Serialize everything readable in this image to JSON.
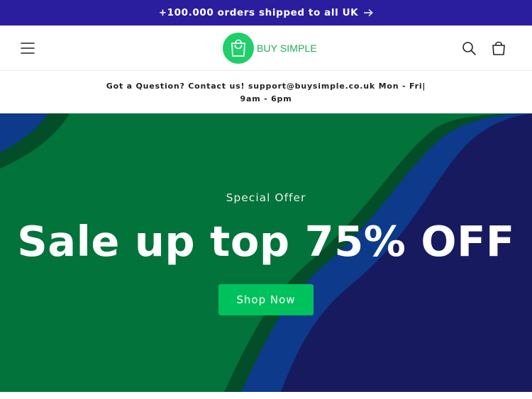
{
  "announcement": {
    "text": "+100.000 orders shipped to all UK",
    "arrow_icon": "arrow-right-icon"
  },
  "header": {
    "brand": "BUY SIMPLE",
    "icons": {
      "menu": "hamburger-menu-icon",
      "logo": "shopping-bag-icon",
      "search": "search-icon",
      "cart": "cart-icon"
    }
  },
  "contact": {
    "text": "Got a Question? Contact us! support@buysimple.co.uk Mon - Fri| 9am - 6pm"
  },
  "hero": {
    "eyebrow": "Special Offer",
    "headline": "Sale up top 75% OFF",
    "button_label": "Shop Now"
  },
  "colors": {
    "announcement_bg": "#2b1e9e",
    "brand_green": "#1fae4f",
    "hero_green": "#02733a",
    "hero_dark_green": "#034d28",
    "hero_blue": "#0d3a8a",
    "hero_navy": "#171a5e",
    "button_green": "#00c25c"
  }
}
